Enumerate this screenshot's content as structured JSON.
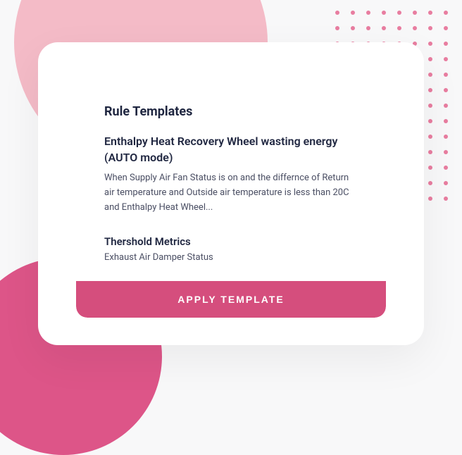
{
  "section": {
    "title": "Rule Templates"
  },
  "rule": {
    "title": "Enthalpy Heat Recovery Wheel wasting energy (AUTO mode)",
    "description": "When Supply Air Fan Status is on and the differnce of Return air temperature and Outside air temperature is less than 20C and Enthalpy Heat Wheel..."
  },
  "metrics": {
    "title": "Thershold Metrics",
    "value": "Exhaust Air Damper Status"
  },
  "button": {
    "apply_label": "APPLY TEMPLATE"
  }
}
